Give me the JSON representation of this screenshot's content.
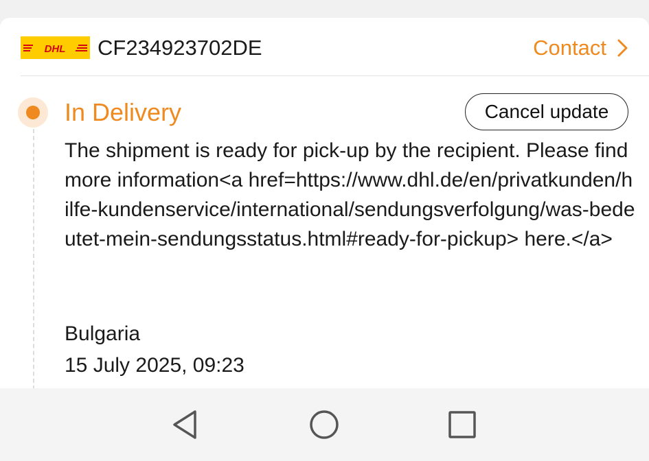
{
  "shipment": {
    "carrier_logo_text": "DHL",
    "tracking_number": "CF234923702DE",
    "contact_label": "Contact",
    "brand_color": "#ffcc00",
    "brand_text_color": "#d40511"
  },
  "status": {
    "title": "In Delivery",
    "cancel_label": "Cancel update",
    "accent_color": "#ee8a1f"
  },
  "event": {
    "message": "The shipment is ready for pick-up by the recipient. Please find more information<a href=https://www.dhl.de/en/privatkunden/hilfe-kundenservice/international/sendungsverfolgung/was-bedeutet-mein-sendungsstatus.html#ready-for-pickup> here.</a>",
    "location": "Bulgaria",
    "datetime": "15 July 2025, 09:23"
  },
  "navigation": {
    "icons": [
      "back-icon",
      "home-icon",
      "recents-icon"
    ]
  }
}
